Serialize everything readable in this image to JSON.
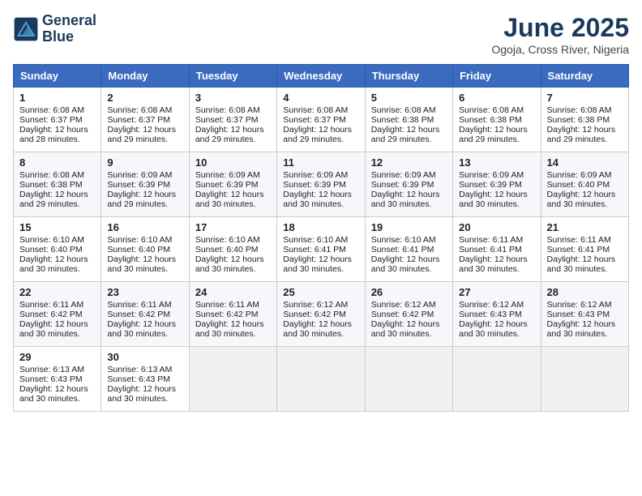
{
  "header": {
    "logo_line1": "General",
    "logo_line2": "Blue",
    "title": "June 2025",
    "subtitle": "Ogoja, Cross River, Nigeria"
  },
  "weekdays": [
    "Sunday",
    "Monday",
    "Tuesday",
    "Wednesday",
    "Thursday",
    "Friday",
    "Saturday"
  ],
  "weeks": [
    [
      {
        "day": "1",
        "sunrise": "6:08 AM",
        "sunset": "6:37 PM",
        "daylight": "12 hours and 28 minutes."
      },
      {
        "day": "2",
        "sunrise": "6:08 AM",
        "sunset": "6:37 PM",
        "daylight": "12 hours and 29 minutes."
      },
      {
        "day": "3",
        "sunrise": "6:08 AM",
        "sunset": "6:37 PM",
        "daylight": "12 hours and 29 minutes."
      },
      {
        "day": "4",
        "sunrise": "6:08 AM",
        "sunset": "6:37 PM",
        "daylight": "12 hours and 29 minutes."
      },
      {
        "day": "5",
        "sunrise": "6:08 AM",
        "sunset": "6:38 PM",
        "daylight": "12 hours and 29 minutes."
      },
      {
        "day": "6",
        "sunrise": "6:08 AM",
        "sunset": "6:38 PM",
        "daylight": "12 hours and 29 minutes."
      },
      {
        "day": "7",
        "sunrise": "6:08 AM",
        "sunset": "6:38 PM",
        "daylight": "12 hours and 29 minutes."
      }
    ],
    [
      {
        "day": "8",
        "sunrise": "6:08 AM",
        "sunset": "6:38 PM",
        "daylight": "12 hours and 29 minutes."
      },
      {
        "day": "9",
        "sunrise": "6:09 AM",
        "sunset": "6:39 PM",
        "daylight": "12 hours and 29 minutes."
      },
      {
        "day": "10",
        "sunrise": "6:09 AM",
        "sunset": "6:39 PM",
        "daylight": "12 hours and 30 minutes."
      },
      {
        "day": "11",
        "sunrise": "6:09 AM",
        "sunset": "6:39 PM",
        "daylight": "12 hours and 30 minutes."
      },
      {
        "day": "12",
        "sunrise": "6:09 AM",
        "sunset": "6:39 PM",
        "daylight": "12 hours and 30 minutes."
      },
      {
        "day": "13",
        "sunrise": "6:09 AM",
        "sunset": "6:39 PM",
        "daylight": "12 hours and 30 minutes."
      },
      {
        "day": "14",
        "sunrise": "6:09 AM",
        "sunset": "6:40 PM",
        "daylight": "12 hours and 30 minutes."
      }
    ],
    [
      {
        "day": "15",
        "sunrise": "6:10 AM",
        "sunset": "6:40 PM",
        "daylight": "12 hours and 30 minutes."
      },
      {
        "day": "16",
        "sunrise": "6:10 AM",
        "sunset": "6:40 PM",
        "daylight": "12 hours and 30 minutes."
      },
      {
        "day": "17",
        "sunrise": "6:10 AM",
        "sunset": "6:40 PM",
        "daylight": "12 hours and 30 minutes."
      },
      {
        "day": "18",
        "sunrise": "6:10 AM",
        "sunset": "6:41 PM",
        "daylight": "12 hours and 30 minutes."
      },
      {
        "day": "19",
        "sunrise": "6:10 AM",
        "sunset": "6:41 PM",
        "daylight": "12 hours and 30 minutes."
      },
      {
        "day": "20",
        "sunrise": "6:11 AM",
        "sunset": "6:41 PM",
        "daylight": "12 hours and 30 minutes."
      },
      {
        "day": "21",
        "sunrise": "6:11 AM",
        "sunset": "6:41 PM",
        "daylight": "12 hours and 30 minutes."
      }
    ],
    [
      {
        "day": "22",
        "sunrise": "6:11 AM",
        "sunset": "6:42 PM",
        "daylight": "12 hours and 30 minutes."
      },
      {
        "day": "23",
        "sunrise": "6:11 AM",
        "sunset": "6:42 PM",
        "daylight": "12 hours and 30 minutes."
      },
      {
        "day": "24",
        "sunrise": "6:11 AM",
        "sunset": "6:42 PM",
        "daylight": "12 hours and 30 minutes."
      },
      {
        "day": "25",
        "sunrise": "6:12 AM",
        "sunset": "6:42 PM",
        "daylight": "12 hours and 30 minutes."
      },
      {
        "day": "26",
        "sunrise": "6:12 AM",
        "sunset": "6:42 PM",
        "daylight": "12 hours and 30 minutes."
      },
      {
        "day": "27",
        "sunrise": "6:12 AM",
        "sunset": "6:43 PM",
        "daylight": "12 hours and 30 minutes."
      },
      {
        "day": "28",
        "sunrise": "6:12 AM",
        "sunset": "6:43 PM",
        "daylight": "12 hours and 30 minutes."
      }
    ],
    [
      {
        "day": "29",
        "sunrise": "6:13 AM",
        "sunset": "6:43 PM",
        "daylight": "12 hours and 30 minutes."
      },
      {
        "day": "30",
        "sunrise": "6:13 AM",
        "sunset": "6:43 PM",
        "daylight": "12 hours and 30 minutes."
      },
      null,
      null,
      null,
      null,
      null
    ]
  ]
}
